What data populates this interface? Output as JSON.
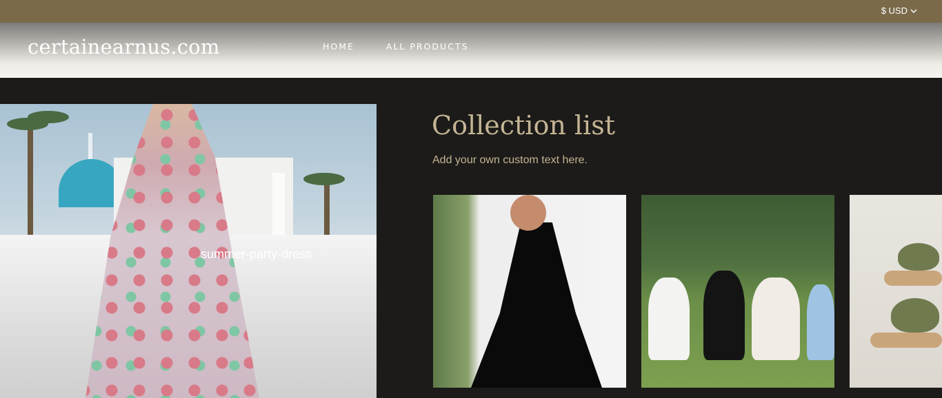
{
  "topbar": {
    "currency_label": "$ USD",
    "background": "#7a6a4a"
  },
  "header": {
    "logo": "certainearnus.com",
    "nav": [
      {
        "label": "HOME"
      },
      {
        "label": "ALL PRODUCTS"
      }
    ]
  },
  "hero": {
    "label": "summer-party-dress"
  },
  "collection": {
    "title": "Collection list",
    "subtitle": "Add your own custom text here.",
    "accent": "#c4b594"
  },
  "icons": {
    "currency_chevron": "chevron-down-icon"
  }
}
